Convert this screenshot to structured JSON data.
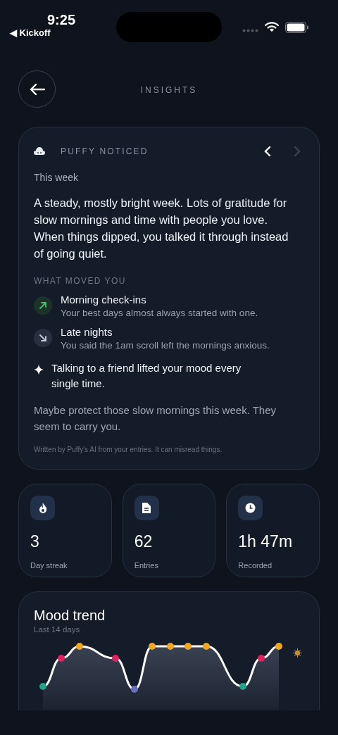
{
  "status_bar": {
    "time": "9:25",
    "back_app": "◀ Kickoff"
  },
  "header": {
    "title": "INSIGHTS"
  },
  "insight": {
    "label": "PUFFY NOTICED",
    "prev_enabled": true,
    "next_enabled": false,
    "period": "This week",
    "summary": "A steady, mostly bright week. Lots of gratitude for slow mornings and time with people you love. When things dipped, you talked it through instead of going quiet.",
    "section_title": "WHAT MOVED YOU",
    "factors": [
      {
        "kind": "up",
        "title": "Morning check-ins",
        "detail": "Your best days almost always started with one."
      },
      {
        "kind": "down",
        "title": "Late nights",
        "detail": "You said the 1am scroll left the mornings anxious."
      }
    ],
    "highlight": "Talking to a friend lifted your mood every single time.",
    "suggestion": "Maybe protect those slow mornings this week. They seem to carry you.",
    "disclaimer": "Written by Puffy's AI from your entries. It can misread things."
  },
  "stats": [
    {
      "kind": "flame",
      "value": "3",
      "label": "Day streak"
    },
    {
      "kind": "document",
      "value": "62",
      "label": "Entries"
    },
    {
      "kind": "clock",
      "value": "1h 47m",
      "label": "Recorded"
    }
  ],
  "mood_trend": {
    "title": "Mood trend",
    "subtitle": "Last 14 days"
  }
}
